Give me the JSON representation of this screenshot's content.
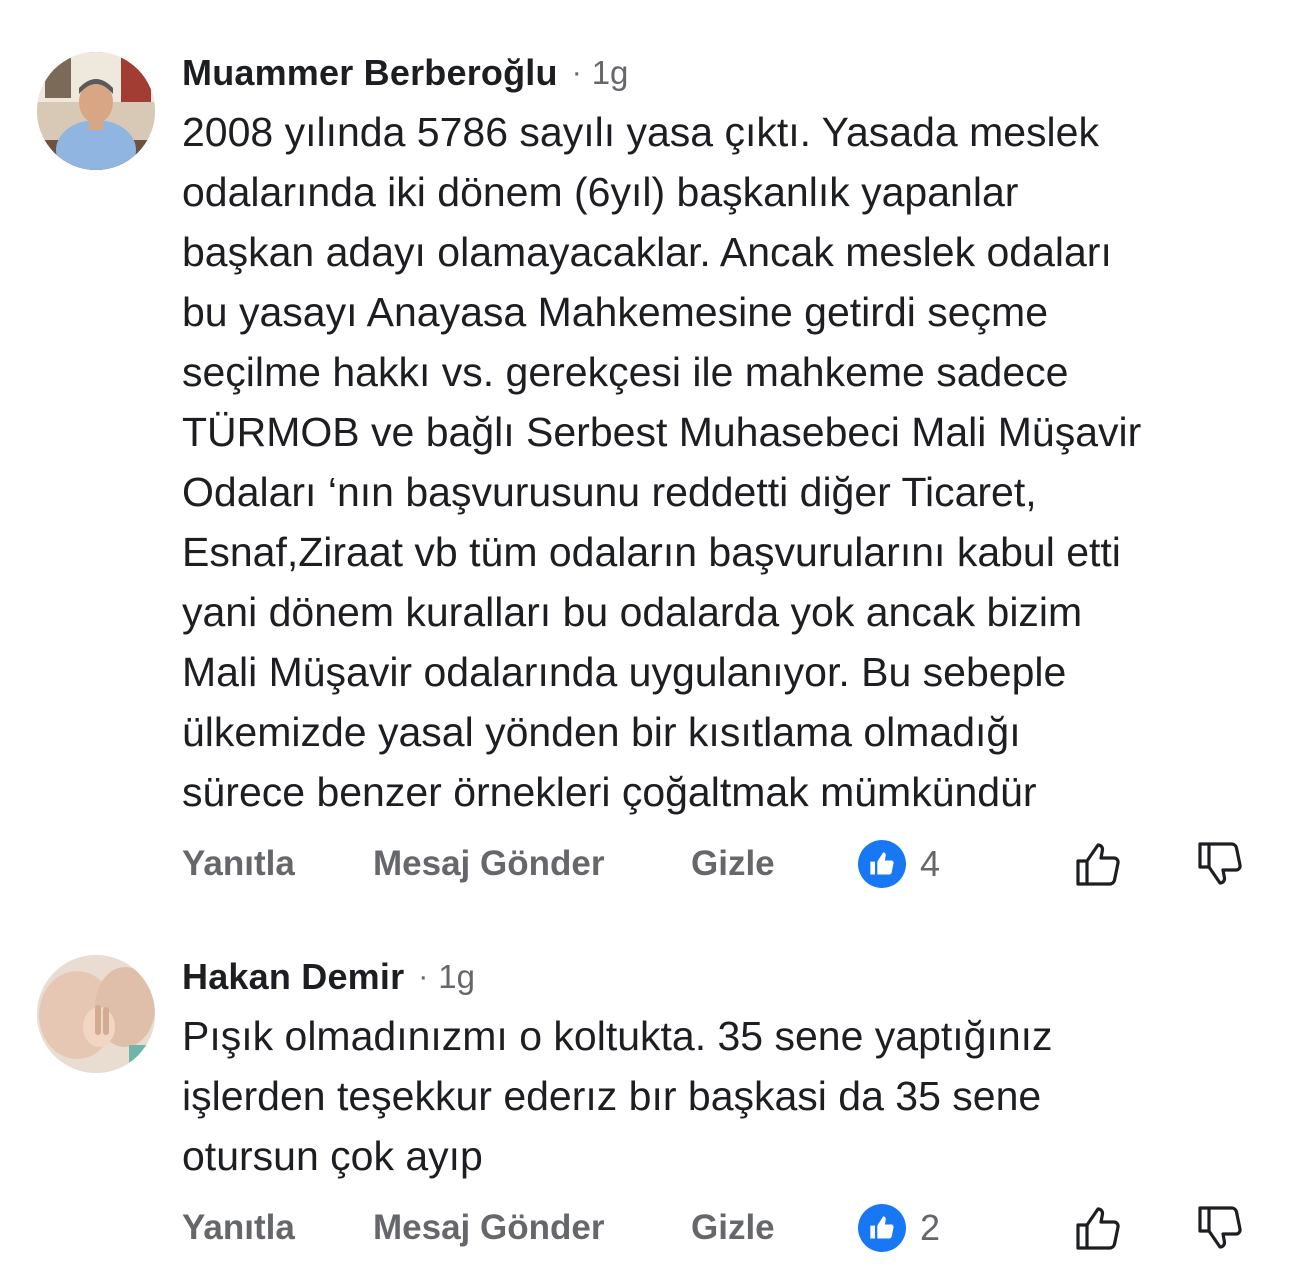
{
  "comments": [
    {
      "author": "Muammer Berberoğlu",
      "separator": "·",
      "time": "1g",
      "lines": [
        "2008 yılında 5786 sayılı yasa çıktı. Yasada meslek",
        "odalarında iki dönem (6yıl) başkanlık yapanlar",
        "başkan adayı olamayacaklar. Ancak meslek odaları",
        "bu yasayı Anayasa Mahkemesine getirdi seçme",
        "seçilme hakkı vs. gerekçesi ile mahkeme sadece",
        "TÜRMOB ve bağlı Serbest Muhasebeci Mali Müşavir",
        "Odaları ‘nın başvurusunu reddetti diğer Ticaret,",
        "Esnaf,Ziraat vb tüm odaların başvurularını kabul etti",
        "yani dönem kuralları bu odalarda yok ancak bizim",
        "Mali Müşavir odalarında uygulanıyor. Bu sebeple",
        "ülkemizde yasal yönden bir kısıtlama olmadığı",
        "sürece benzer örnekleri çoğaltmak mümkündür"
      ],
      "actions": {
        "reply": "Yanıtla",
        "message": "Mesaj Gönder",
        "hide": "Gizle"
      },
      "like_count": "4"
    },
    {
      "author": "Hakan Demir",
      "separator": "·",
      "time": "1g",
      "lines": [
        "Pışık olmadınızmı o koltukta. 35 sene yaptığınız",
        "işlerden teşekkur ederız bır başkasi da 35 sene",
        "otursun çok ayıp"
      ],
      "actions": {
        "reply": "Yanıtla",
        "message": "Mesaj Gönder",
        "hide": "Gizle"
      },
      "like_count": "2"
    }
  ],
  "colors": {
    "text": "#1c1e21",
    "secondary": "#65676b",
    "like_blue": "#1877f2"
  },
  "icons": [
    "like-reaction-icon",
    "thumbs-up-outline-icon",
    "thumbs-down-outline-icon"
  ]
}
